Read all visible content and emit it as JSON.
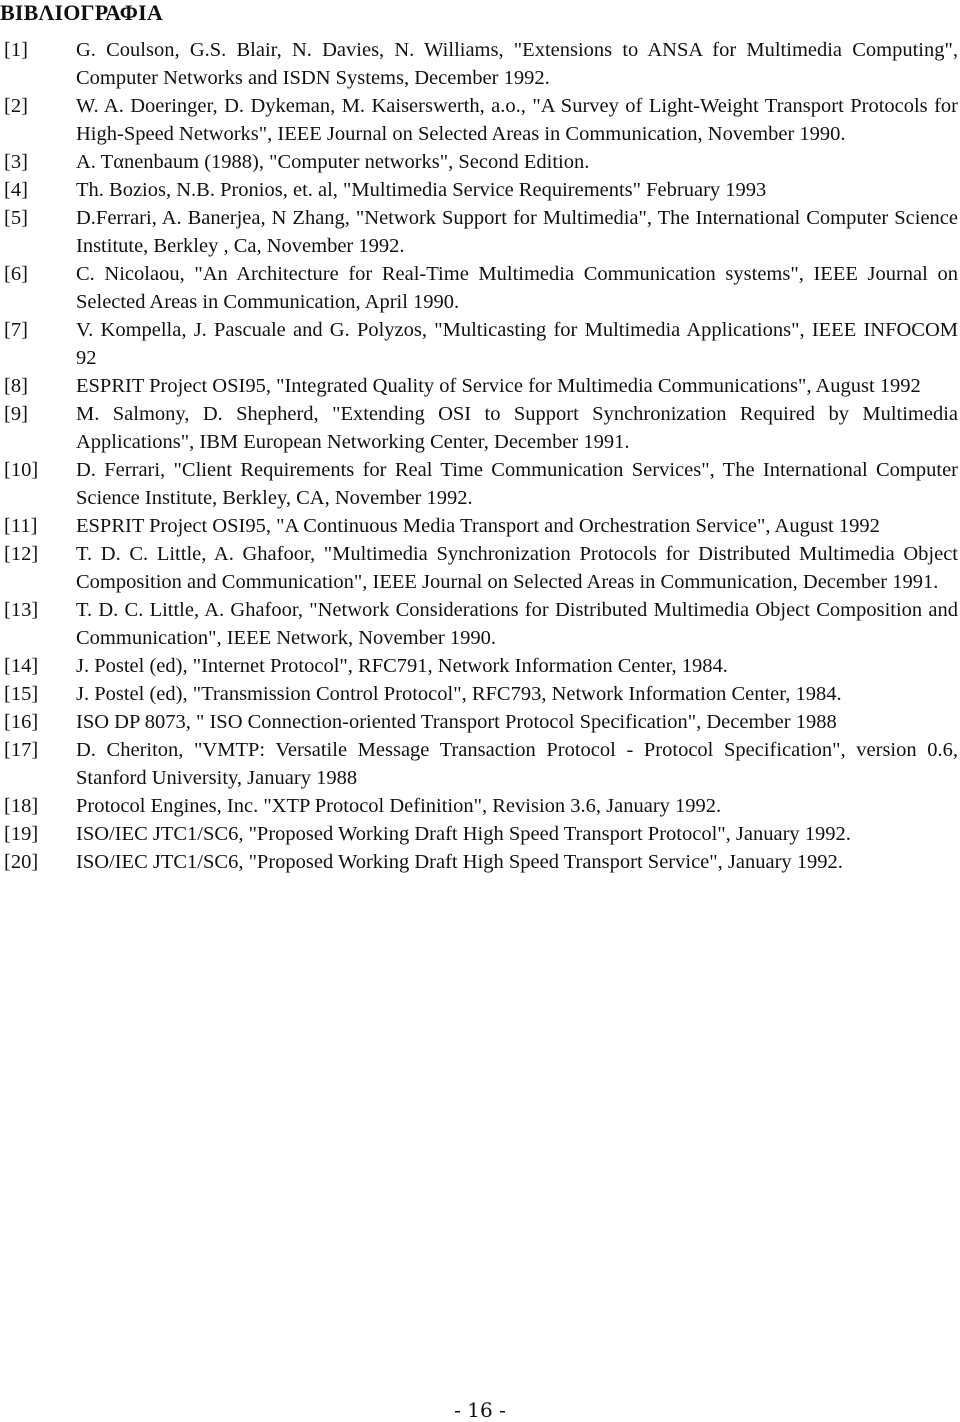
{
  "document": {
    "title": "ΒΙΒΛΙΟΓΡΑΦΙΑ",
    "page_number": "- 16 -",
    "references": [
      {
        "num": "[1]",
        "text": "G. Coulson, G.S. Blair, N. Davies, N. Williams, \"Extensions to ANSA for Multimedia Computing\", Computer Networks and ISDN Systems, December 1992."
      },
      {
        "num": "[2]",
        "text": "W. A. Doeringer, D. Dykeman, M. Kaiserswerth, a.o., \"A Survey of Light-Weight Transport Protocols for High-Speed Networks\", IEEE Journal on Selected Areas in Communication, November 1990."
      },
      {
        "num": "[3]",
        "text": "A. Tαnenbaum (1988), \"Computer networks\", Second Edition."
      },
      {
        "num": "[4]",
        "text": "Th. Bozios, N.B. Pronios, et. al, \"Multimedia Service Requirements\" February 1993"
      },
      {
        "num": "[5]",
        "text": "D.Ferrari, A. Banerjea, N Zhang, \"Network Support for Multimedia\", The International Computer Science Institute, Berkley , Ca, November 1992."
      },
      {
        "num": "[6]",
        "text": "C. Nicolaou, \"An Architecture for Real-Time Multimedia Communication systems\", IEEE Journal on Selected Areas in Communication, April 1990."
      },
      {
        "num": "[7]",
        "text": "V. Kompella, J. Pascuale and G. Polyzos, \"Multicasting for Multimedia Applications\", IEEE INFOCOM 92"
      },
      {
        "num": "[8]",
        "text": "ESPRIT Project OSI95, \"Integrated Quality of Service for Multimedia Communications\", August 1992"
      },
      {
        "num": "[9]",
        "text": "M. Salmony, D. Shepherd, \"Extending OSI to Support Synchronization Required by Multimedia Applications\", IBM European Networking Center, December 1991."
      },
      {
        "num": "[10]",
        "text": "D. Ferrari, \"Client Requirements for Real Time Communication Services\", The International Computer Science Institute, Berkley, CA, November 1992."
      },
      {
        "num": "[11]",
        "text": "ESPRIT Project OSI95, \"A Continuous Media Transport and Orchestration Service\", August 1992"
      },
      {
        "num": "[12]",
        "text": "T. D. C. Little, A. Ghafoor, \"Multimedia Synchronization Protocols for Distributed Multimedia Object Composition and Communication\", IEEE Journal on Selected Areas in Communication, December 1991."
      },
      {
        "num": "[13]",
        "text": "T. D. C. Little, A. Ghafoor, \"Network Considerations for Distributed Multimedia Object Composition and Communication\", IEEE Network, November 1990."
      },
      {
        "num": "[14]",
        "text": "J. Postel (ed), \"Internet Protocol\", RFC791, Network Information Center, 1984."
      },
      {
        "num": "[15]",
        "text": "J. Postel (ed), \"Transmission Control Protocol\", RFC793, Network Information Center, 1984."
      },
      {
        "num": "[16]",
        "text": "ISO DP 8073, \" ISO Connection-oriented Transport Protocol Specification\", December 1988"
      },
      {
        "num": "[17]",
        "text": "D. Cheriton, \"VMTP: Versatile Message Transaction Protocol - Protocol Specification\", version 0.6, Stanford University, January 1988"
      },
      {
        "num": "[18]",
        "text": "Protocol Engines, Inc. \"XTP Protocol Definition\", Revision 3.6, January 1992."
      },
      {
        "num": "[19]",
        "text": "ISO/IEC JTC1/SC6, \"Proposed Working Draft High Speed Transport Protocol\", January 1992."
      },
      {
        "num": "[20]",
        "text": "ISO/IEC JTC1/SC6, \"Proposed Working Draft High Speed Transport Service\", January 1992."
      }
    ]
  }
}
